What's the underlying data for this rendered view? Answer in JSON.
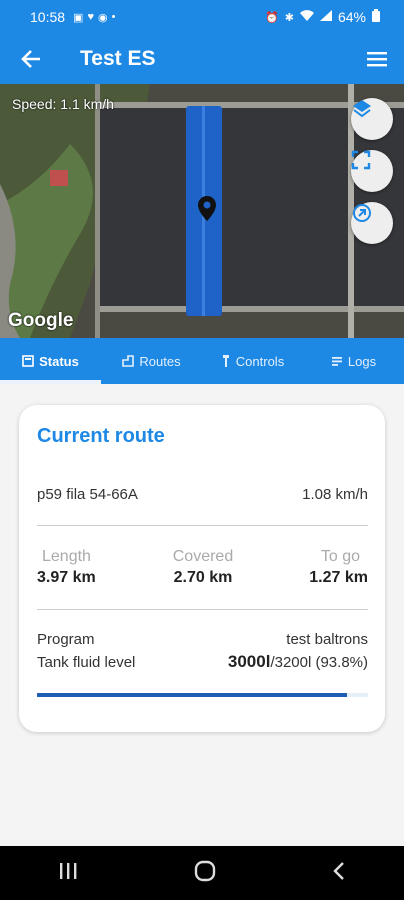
{
  "status_bar": {
    "time": "10:58",
    "battery": "64%"
  },
  "app_bar": {
    "title": "Test ES"
  },
  "map": {
    "speed_text": "Speed: 1.1 km/h",
    "attribution": "Google"
  },
  "tabs": [
    {
      "label": "Status",
      "icon": "status-icon",
      "active": true
    },
    {
      "label": "Routes",
      "icon": "routes-icon",
      "active": false
    },
    {
      "label": "Controls",
      "icon": "controls-icon",
      "active": false
    },
    {
      "label": "Logs",
      "icon": "logs-icon",
      "active": false
    }
  ],
  "card": {
    "heading": "Current route",
    "route_name": "p59 fila 54-66A",
    "speed": "1.08 km/h",
    "stats": [
      {
        "label": "Length",
        "value": "3.97 km"
      },
      {
        "label": "Covered",
        "value": "2.70 km"
      },
      {
        "label": "To go",
        "value": "1.27 km"
      }
    ],
    "program_label": "Program",
    "program_value": "test baltrons",
    "tank_label": "Tank fluid level",
    "tank_current": "3000l",
    "tank_rest": "/3200l (93.8%)",
    "tank_fraction": 0.938
  },
  "colors": {
    "primary": "#1e88e5",
    "progress": "#1e5fb5"
  }
}
